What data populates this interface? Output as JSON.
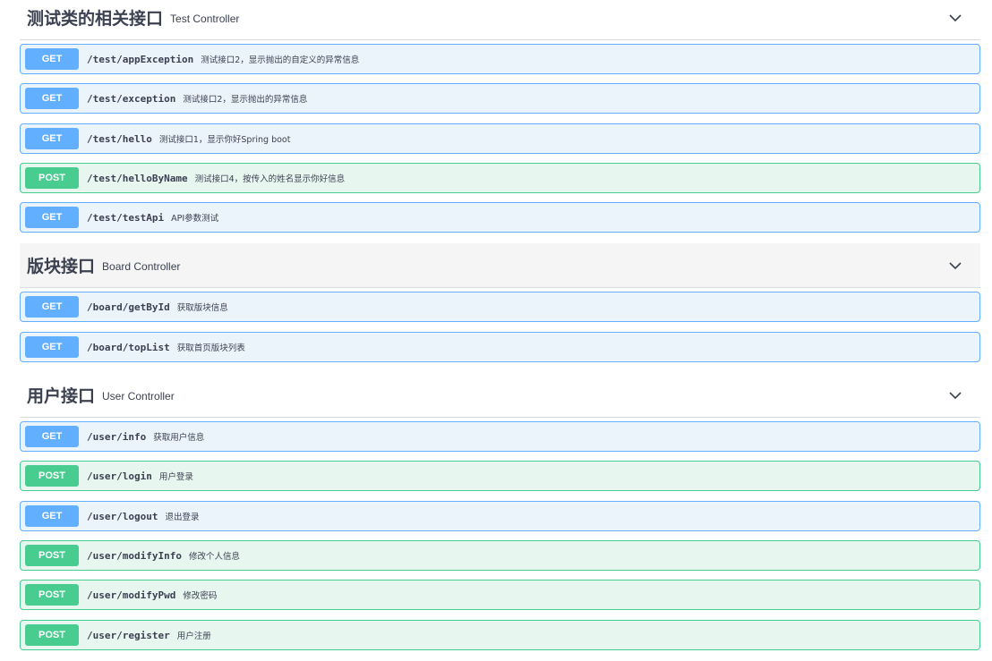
{
  "tags": [
    {
      "name": "测试类的相关接口",
      "description": "Test Controller",
      "operations": [
        {
          "method": "GET",
          "path": "/test/appException",
          "summary": "测试接口2，显示抛出的自定义的异常信息"
        },
        {
          "method": "GET",
          "path": "/test/exception",
          "summary": "测试接口2，显示抛出的异常信息"
        },
        {
          "method": "GET",
          "path": "/test/hello",
          "summary": "测试接口1，显示你好Spring boot"
        },
        {
          "method": "POST",
          "path": "/test/helloByName",
          "summary": "测试接口4，按传入的姓名显示你好信息"
        },
        {
          "method": "GET",
          "path": "/test/testApi",
          "summary": "API参数测试"
        }
      ]
    },
    {
      "name": "版块接口",
      "description": "Board Controller",
      "operations": [
        {
          "method": "GET",
          "path": "/board/getById",
          "summary": "获取版块信息"
        },
        {
          "method": "GET",
          "path": "/board/topList",
          "summary": "获取首页版块列表"
        }
      ]
    },
    {
      "name": "用户接口",
      "description": "User Controller",
      "operations": [
        {
          "method": "GET",
          "path": "/user/info",
          "summary": "获取用户信息"
        },
        {
          "method": "POST",
          "path": "/user/login",
          "summary": "用户登录"
        },
        {
          "method": "GET",
          "path": "/user/logout",
          "summary": "退出登录"
        },
        {
          "method": "POST",
          "path": "/user/modifyInfo",
          "summary": "修改个人信息"
        },
        {
          "method": "POST",
          "path": "/user/modifyPwd",
          "summary": "修改密码"
        },
        {
          "method": "POST",
          "path": "/user/register",
          "summary": "用户注册"
        }
      ]
    }
  ],
  "icons": {
    "collapse": "chevron-down-icon"
  },
  "colors": {
    "get": "#61affe",
    "post": "#49cc90",
    "get_bg": "#ebf3fb",
    "post_bg": "#e8f6f0"
  }
}
